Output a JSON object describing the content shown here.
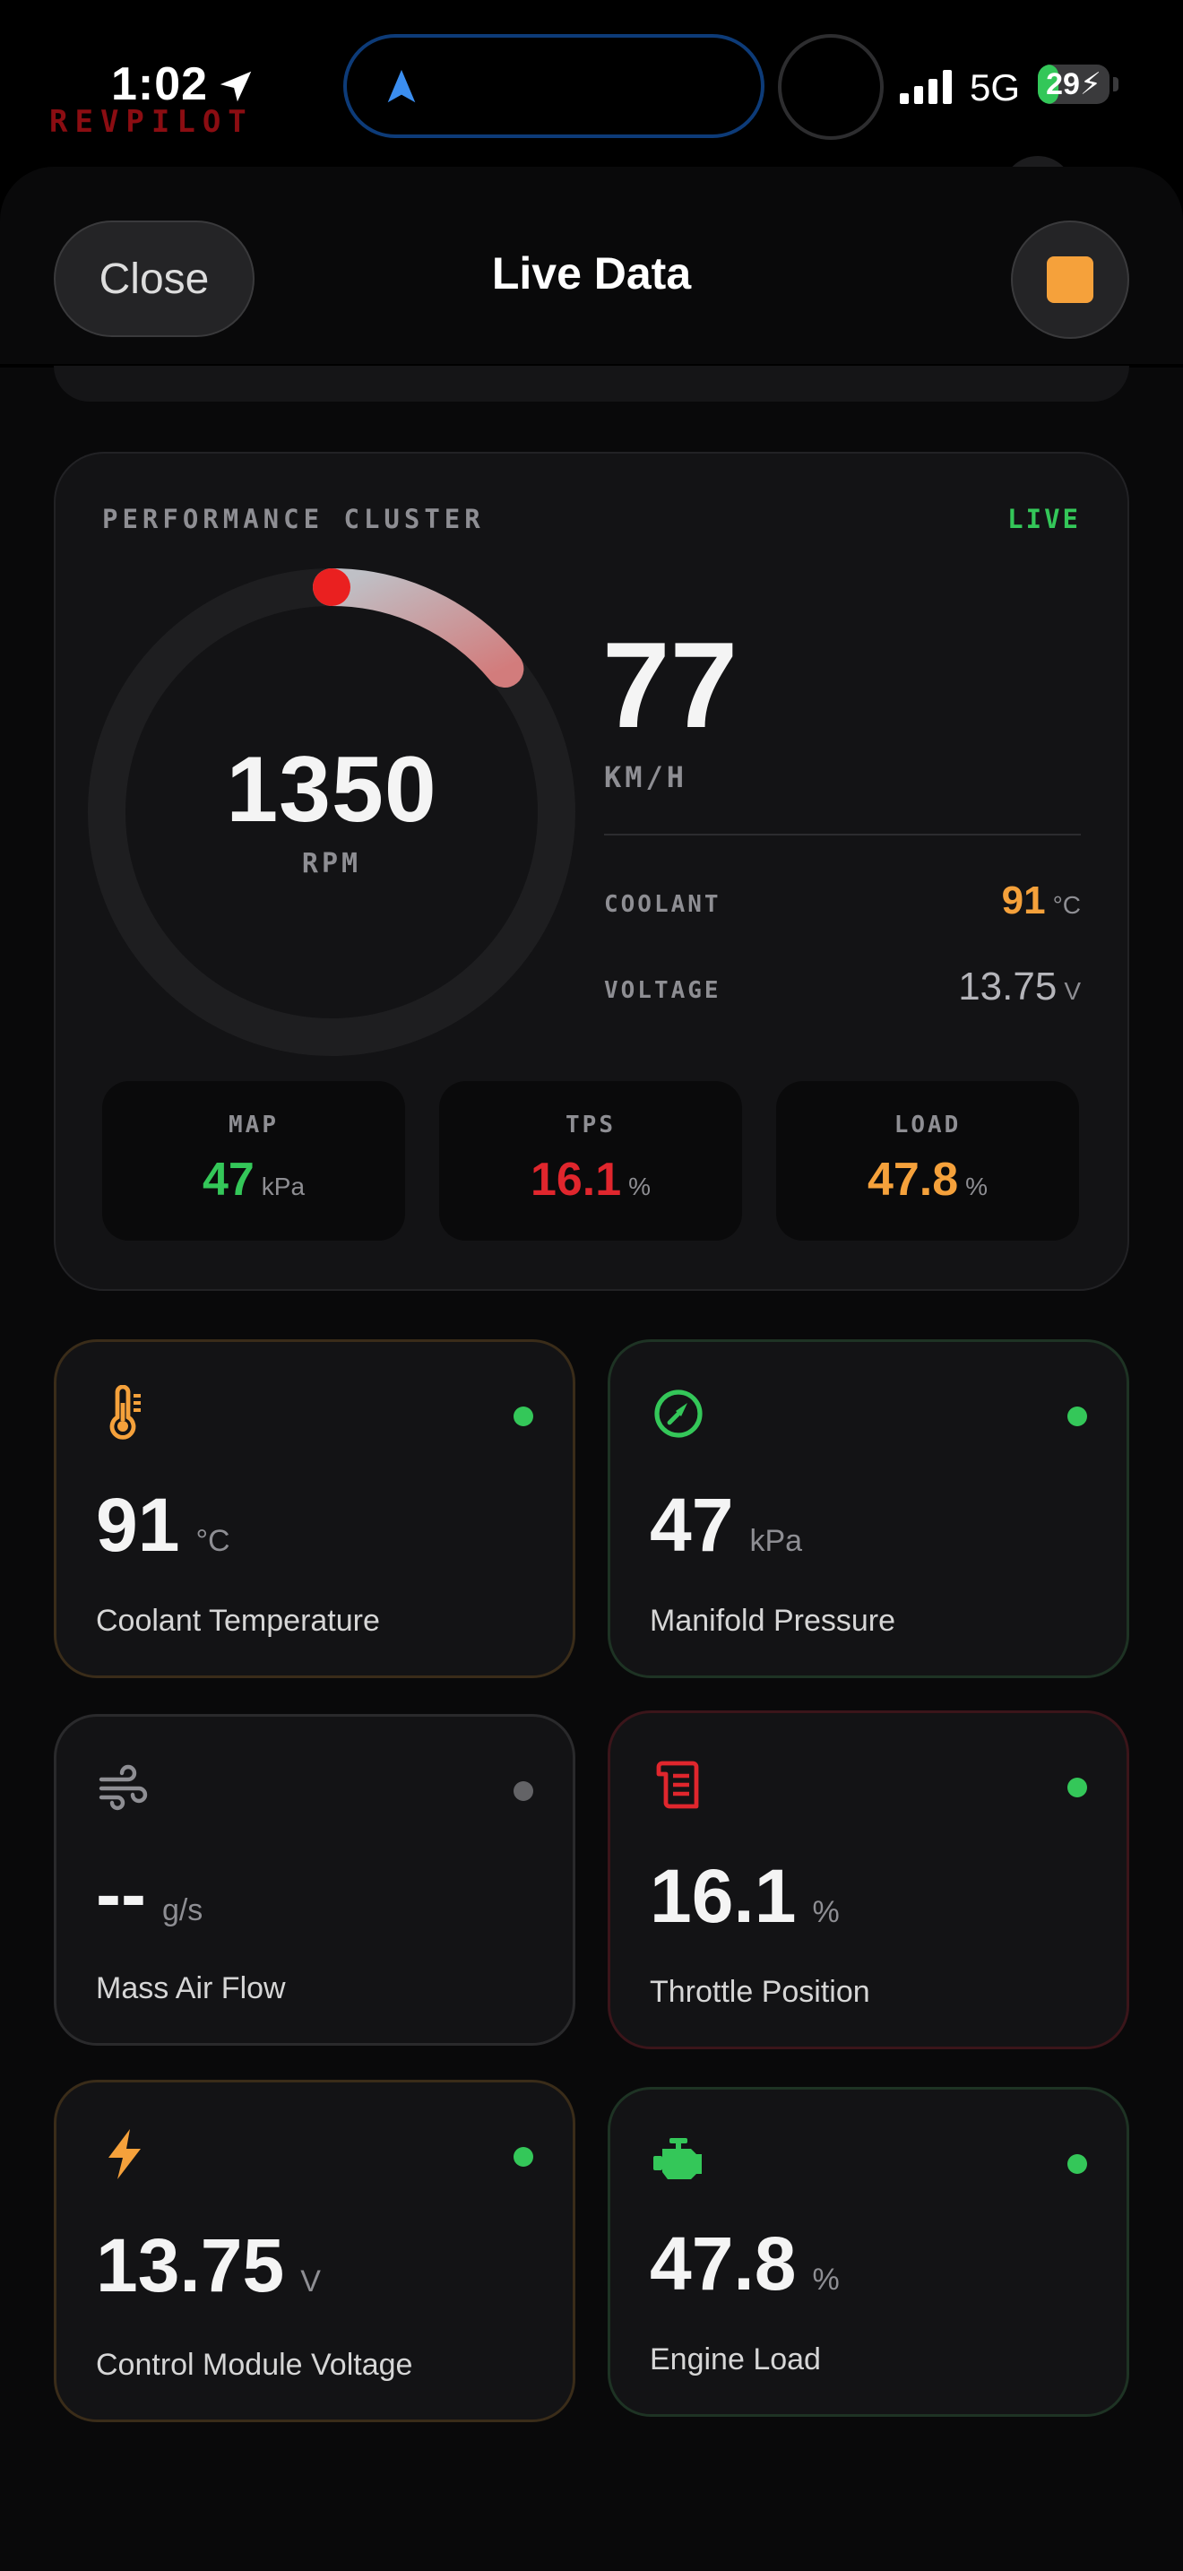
{
  "status_bar": {
    "time": "1:02",
    "network": "5G",
    "battery": "29",
    "battery_level": 0.29,
    "brand": "REVPILOT"
  },
  "sheet": {
    "close_label": "Close",
    "title": "Live Data"
  },
  "cluster": {
    "label": "PERFORMANCE CLUSTER",
    "live": "LIVE",
    "rpm": {
      "value": "1350",
      "unit": "RPM",
      "fraction": 0.14
    },
    "speed": {
      "value": "77",
      "unit": "KM/H"
    },
    "coolant": {
      "label": "COOLANT",
      "value": "91",
      "unit": "°C"
    },
    "voltage": {
      "label": "VOLTAGE",
      "value": "13.75",
      "unit": "V"
    },
    "map": {
      "label": "MAP",
      "value": "47",
      "unit": "kPa"
    },
    "tps": {
      "label": "TPS",
      "value": "16.1",
      "unit": "%"
    },
    "load": {
      "label": "LOAD",
      "value": "47.8",
      "unit": "%"
    }
  },
  "cards": [
    {
      "value": "91",
      "unit": "°C",
      "label": "Coolant Temperature",
      "icon": "thermometer-icon"
    },
    {
      "value": "47",
      "unit": "kPa",
      "label": "Manifold Pressure",
      "icon": "gauge-icon"
    },
    {
      "value": "--",
      "unit": "g/s",
      "label": "Mass Air Flow",
      "icon": "wind-icon"
    },
    {
      "value": "16.1",
      "unit": "%",
      "label": "Throttle Position",
      "icon": "throttle-icon"
    },
    {
      "value": "13.75",
      "unit": "V",
      "label": "Control Module Voltage",
      "icon": "bolt-icon"
    },
    {
      "value": "47.8",
      "unit": "%",
      "label": "Engine Load",
      "icon": "engine-icon"
    }
  ],
  "colors": {
    "accent_orange": "#f5a13b",
    "accent_green": "#34c759",
    "accent_red": "#e0262d",
    "nav_blue": "#3b8ef0",
    "inactive_gray": "#8e8e93"
  }
}
